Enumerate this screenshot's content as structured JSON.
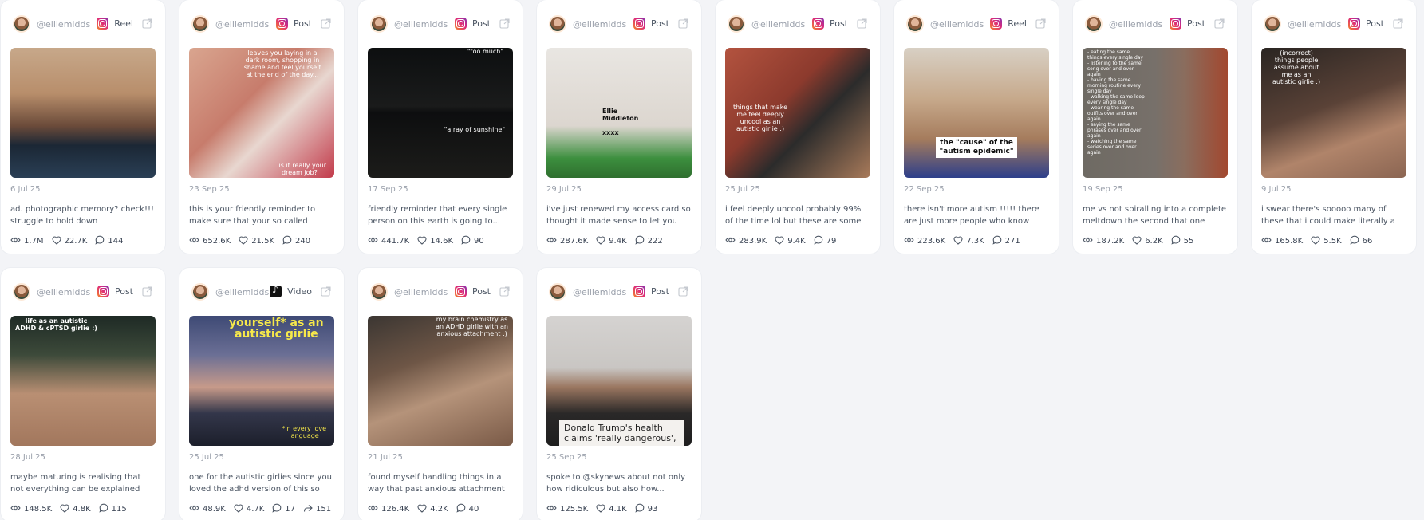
{
  "colors": {
    "background": "#f3f4f7",
    "card": "#ffffff",
    "muted_text": "#9aa0ab",
    "body_text": "#4b5563"
  },
  "handle": "@elliemidds",
  "posts": [
    {
      "platform": "instagram",
      "platform_icon": "instagram-icon",
      "type": "Reel",
      "date": "6 Jul 25",
      "caption": "ad. photographic memory? check!!! struggle to hold down relationships?...",
      "views": "1.7M",
      "likes": "22.7K",
      "comments": "144",
      "overlay": "",
      "thumb_bg": "linear-gradient(180deg,#c7a88a 0%,#b88e6b 35%,#6b4b3a 60%,#1b2735 75%,#2a3f55 100%)"
    },
    {
      "platform": "instagram",
      "platform_icon": "instagram-icon",
      "type": "Post",
      "date": "23 Sep 25",
      "caption": "this is your friendly reminder to make sure that your so called dreams are...",
      "views": "652.6K",
      "likes": "21.5K",
      "comments": "240",
      "overlay": "leaves you laying in a\ndark room, shopping in\nshame and feel yourself\nat the end of the day...",
      "overlay2": "...is it really your\ndream job?",
      "thumb_bg": "linear-gradient(135deg,#d9a58f 0%,#c77c6c 40%,#e8d7d0 60%,#c23a4a 100%)"
    },
    {
      "platform": "instagram",
      "platform_icon": "instagram-icon",
      "type": "Post",
      "date": "17 Sep 25",
      "caption": "friendly reminder that every single person on this earth is going to...",
      "views": "441.7K",
      "likes": "14.6K",
      "comments": "90",
      "overlay": "\"too much\"",
      "overlay2": "\"a ray of sunshine\"",
      "thumb_bg": "linear-gradient(180deg,#0d0f10 0%,#1a1b1b 45%,#0d0e0f 50%,#1c1c1a 100%)"
    },
    {
      "platform": "instagram",
      "platform_icon": "instagram-icon",
      "type": "Post",
      "date": "29 Jul 25",
      "caption": "i've just renewed my access card so thought it made sense to let you kno...",
      "views": "287.6K",
      "likes": "9.4K",
      "comments": "222",
      "overlay": "Ellie\nMiddleton",
      "overlay2": "xxxx",
      "thumb_bg": "linear-gradient(180deg,#e9e6e2 0%,#dcd6cf 60%,#3c8f3e 85%,#2f6f2f 100%)"
    },
    {
      "platform": "instagram",
      "platform_icon": "instagram-icon",
      "type": "Post",
      "date": "25 Jul 25",
      "caption": "i feel deeply uncool probably 99% of the time lol but these are some of the...",
      "views": "283.9K",
      "likes": "9.4K",
      "comments": "79",
      "overlay": "things that make\nme feel deeply\nuncool as an\nautistic girlie :)",
      "thumb_bg": "linear-gradient(135deg,#b3533f 0%,#8c3a2d 40%,#2b2b2b 60%,#a87a5a 100%)"
    },
    {
      "platform": "instagram",
      "platform_icon": "instagram-icon",
      "type": "Reel",
      "date": "22 Sep 25",
      "caption": "there isn't more autism !!!!! there are just more people who know what...",
      "views": "223.6K",
      "likes": "7.3K",
      "comments": "271",
      "overlay": "the \"cause\" of the\n\"autism epidemic\"",
      "thumb_bg": "linear-gradient(180deg,#d8d0c4 0%,#c6a88a 40%,#a57c5d 70%,#2d3f8a 100%)"
    },
    {
      "platform": "instagram",
      "platform_icon": "instagram-icon",
      "type": "Post",
      "date": "19 Sep 25",
      "caption": "me vs not spiralling into a complete meltdown the second that one tiny...",
      "views": "187.2K",
      "likes": "6.2K",
      "comments": "55",
      "overlay": "- eating the same\nthings every single day\n- listening to the same\nsong over and over\nagain\n- having the same\nmorning routine every\nsingle day\n- walking the same loop\nevery single day\n- wearing the same\noutfits over and over\nagain\n- saying the same\nphrases over and over\nagain\n- watching the same\nseries over and over\nagain",
      "thumb_bg": "linear-gradient(90deg,#6e6a63 0%,#77706a 50%,#8a6d5e 70%,#a2482f 100%)"
    },
    {
      "platform": "instagram",
      "platform_icon": "instagram-icon",
      "type": "Post",
      "date": "9 Jul 25",
      "caption": "i swear there's sooooo many of these that i could make literally a hundred...",
      "views": "165.8K",
      "likes": "5.5K",
      "comments": "66",
      "overlay": "(incorrect)\nthings people\nassume about\nme as an\nautistic girlie :)",
      "thumb_bg": "linear-gradient(160deg,#2a2522 0%,#5a4237 45%,#b0846a 70%,#8b6552 100%)"
    },
    {
      "platform": "instagram",
      "platform_icon": "instagram-icon",
      "type": "Post",
      "date": "28 Jul 25",
      "caption": "maybe maturing is realising that not everything can be explained logically...",
      "views": "148.5K",
      "likes": "4.8K",
      "comments": "115",
      "overlay": "life as an autistic\nADHD & cPTSD girlie :)",
      "thumb_bg": "linear-gradient(180deg,#1e2a25 0%,#3d4a3a 30%,#b98f73 60%,#a2775d 100%)"
    },
    {
      "platform": "tiktok",
      "platform_icon": "tiktok-icon",
      "type": "Video",
      "date": "25 Jul 25",
      "caption": "one for the autistic girlies since you loved the adhd version of this so muc...",
      "views": "48.9K",
      "likes": "4.7K",
      "comments": "17",
      "shares": "151",
      "overlay": "yourself* as an\nautistic girlie",
      "overlay2": "*in every love\nlanguage",
      "thumb_bg": "linear-gradient(180deg,#3e4a75 0%,#6b6f95 30%,#c79a8a 55%,#33364a 75%,#1c1f2b 100%)"
    },
    {
      "platform": "instagram",
      "platform_icon": "instagram-icon",
      "type": "Post",
      "date": "21 Jul 25",
      "caption": "found myself handling things in a way that past anxious attachment ellie...",
      "views": "126.4K",
      "likes": "4.2K",
      "comments": "40",
      "overlay": "my brain chemistry as\nan ADHD girlie with an\nanxious attachment :)",
      "thumb_bg": "linear-gradient(160deg,#3b3632 0%,#6e5646 35%,#b5937a 60%,#7a5a47 100%)"
    },
    {
      "platform": "instagram",
      "platform_icon": "instagram-icon",
      "type": "Post",
      "date": "25 Sep 25",
      "caption": "spoke to @skynews about not only how ridiculous but also how...",
      "views": "125.5K",
      "likes": "4.1K",
      "comments": "93",
      "overlay": "Donald Trump's health\nclaims 'really dangerous',",
      "thumb_bg": "linear-gradient(180deg,#d5d3d1 0%,#c9c6c3 40%,#9a7660 55%,#2a2828 75%,#1e1e1e 100%)"
    }
  ]
}
